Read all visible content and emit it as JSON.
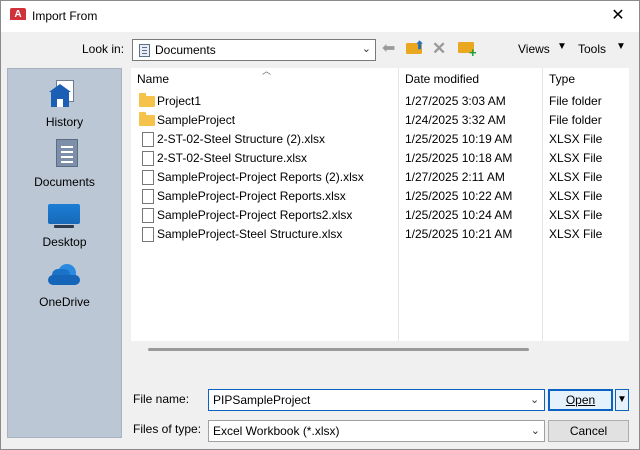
{
  "window": {
    "title": "Import From",
    "close_glyph": "✕"
  },
  "toolbar": {
    "look_in_label": "Look in:",
    "look_in_value": "Documents",
    "views_label": "Views",
    "tools_label": "Tools",
    "icons": [
      "back-icon",
      "up-one-level-icon",
      "delete-icon",
      "create-new-folder-icon"
    ]
  },
  "places": [
    {
      "label": "History",
      "icon": "history-icon"
    },
    {
      "label": "Documents",
      "icon": "documents-icon"
    },
    {
      "label": "Desktop",
      "icon": "desktop-icon"
    },
    {
      "label": "OneDrive",
      "icon": "onedrive-icon"
    }
  ],
  "file_list": {
    "columns": [
      "Name",
      "Date modified",
      "Type"
    ],
    "rows": [
      {
        "name": "Project1",
        "date": "1/27/2025 3:03 AM",
        "type": "File folder",
        "kind": "folder"
      },
      {
        "name": "SampleProject",
        "date": "1/24/2025 3:32 AM",
        "type": "File folder",
        "kind": "folder"
      },
      {
        "name": "2-ST-02-Steel Structure (2).xlsx",
        "date": "1/25/2025 10:19 AM",
        "type": "XLSX File",
        "kind": "file"
      },
      {
        "name": "2-ST-02-Steel Structure.xlsx",
        "date": "1/25/2025 10:18 AM",
        "type": "XLSX File",
        "kind": "file"
      },
      {
        "name": "SampleProject-Project Reports (2).xlsx",
        "date": "1/27/2025 2:11 AM",
        "type": "XLSX File",
        "kind": "file"
      },
      {
        "name": "SampleProject-Project Reports.xlsx",
        "date": "1/25/2025 10:22 AM",
        "type": "XLSX File",
        "kind": "file"
      },
      {
        "name": "SampleProject-Project Reports2.xlsx",
        "date": "1/25/2025 10:24 AM",
        "type": "XLSX File",
        "kind": "file"
      },
      {
        "name": "SampleProject-Steel Structure.xlsx",
        "date": "1/25/2025 10:21 AM",
        "type": "XLSX File",
        "kind": "file"
      }
    ]
  },
  "footer": {
    "file_name_label": "File name:",
    "file_name_value": "PIPSampleProject",
    "files_of_type_label": "Files of type:",
    "files_of_type_value": "Excel Workbook (*.xlsx)",
    "open_label": "Open",
    "cancel_label": "Cancel"
  },
  "colors": {
    "places_bg": "#bcc7d5",
    "accent": "#0b62c4",
    "folder": "#f5c24a"
  }
}
